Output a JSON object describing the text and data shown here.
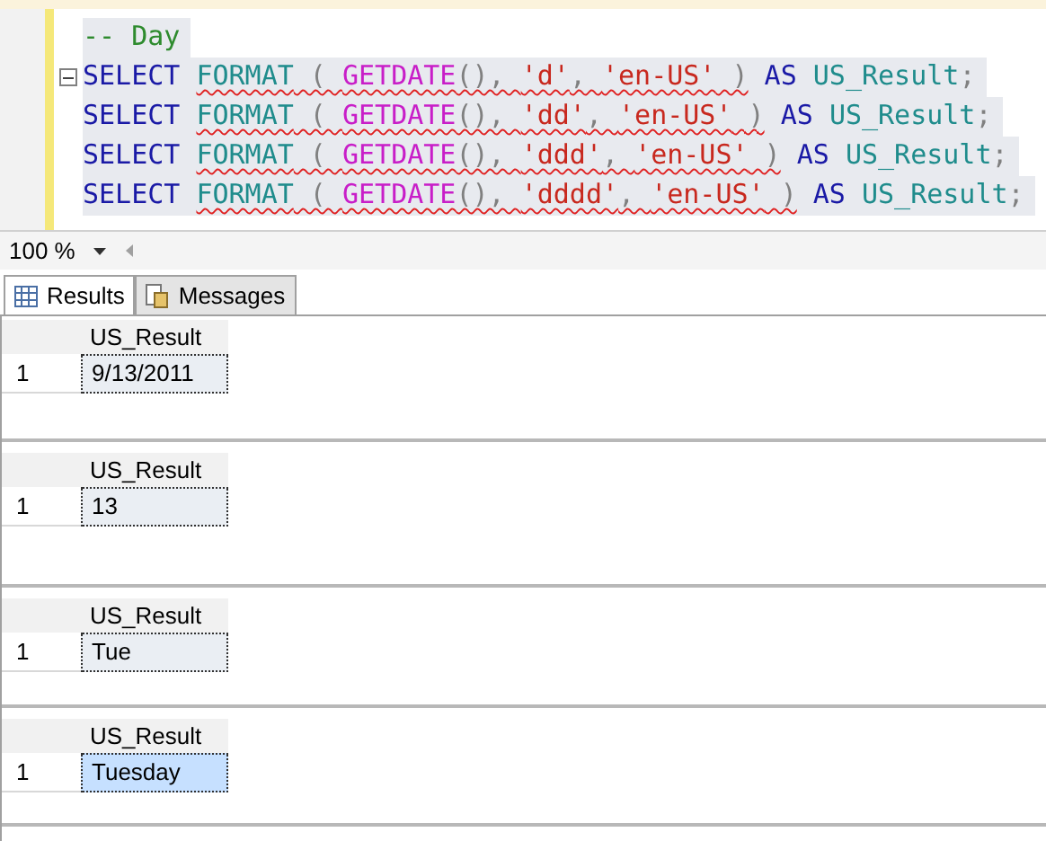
{
  "editor": {
    "lines": [
      {
        "collapse": false,
        "tokens": [
          {
            "kind": "comment",
            "text": "-- Day",
            "error": false
          }
        ]
      },
      {
        "collapse": true,
        "tokens": [
          {
            "kind": "keyword",
            "text": "SELECT ",
            "error": false
          },
          {
            "kind": "function",
            "text": "FORMAT",
            "error": true
          },
          {
            "kind": "punct",
            "text": " ( ",
            "error": true
          },
          {
            "kind": "system",
            "text": "GETDATE",
            "error": true
          },
          {
            "kind": "punct",
            "text": "(), ",
            "error": true
          },
          {
            "kind": "string",
            "text": "'d'",
            "error": true
          },
          {
            "kind": "punct",
            "text": ", ",
            "error": true
          },
          {
            "kind": "string",
            "text": "'en-US'",
            "error": true
          },
          {
            "kind": "punct",
            "text": " )",
            "error": true
          },
          {
            "kind": "keyword",
            "text": " AS ",
            "error": false
          },
          {
            "kind": "identifier",
            "text": "US_Result",
            "error": false
          },
          {
            "kind": "punct",
            "text": ";",
            "error": false
          }
        ]
      },
      {
        "collapse": false,
        "tokens": [
          {
            "kind": "keyword",
            "text": "SELECT ",
            "error": false
          },
          {
            "kind": "function",
            "text": "FORMAT",
            "error": true
          },
          {
            "kind": "punct",
            "text": " ( ",
            "error": true
          },
          {
            "kind": "system",
            "text": "GETDATE",
            "error": true
          },
          {
            "kind": "punct",
            "text": "(), ",
            "error": true
          },
          {
            "kind": "string",
            "text": "'dd'",
            "error": true
          },
          {
            "kind": "punct",
            "text": ", ",
            "error": true
          },
          {
            "kind": "string",
            "text": "'en-US'",
            "error": true
          },
          {
            "kind": "punct",
            "text": " )",
            "error": true
          },
          {
            "kind": "keyword",
            "text": " AS ",
            "error": false
          },
          {
            "kind": "identifier",
            "text": "US_Result",
            "error": false
          },
          {
            "kind": "punct",
            "text": ";",
            "error": false
          }
        ]
      },
      {
        "collapse": false,
        "tokens": [
          {
            "kind": "keyword",
            "text": "SELECT ",
            "error": false
          },
          {
            "kind": "function",
            "text": "FORMAT",
            "error": true
          },
          {
            "kind": "punct",
            "text": " ( ",
            "error": true
          },
          {
            "kind": "system",
            "text": "GETDATE",
            "error": true
          },
          {
            "kind": "punct",
            "text": "(), ",
            "error": true
          },
          {
            "kind": "string",
            "text": "'ddd'",
            "error": true
          },
          {
            "kind": "punct",
            "text": ", ",
            "error": true
          },
          {
            "kind": "string",
            "text": "'en-US'",
            "error": true
          },
          {
            "kind": "punct",
            "text": " )",
            "error": true
          },
          {
            "kind": "keyword",
            "text": " AS ",
            "error": false
          },
          {
            "kind": "identifier",
            "text": "US_Result",
            "error": false
          },
          {
            "kind": "punct",
            "text": ";",
            "error": false
          }
        ]
      },
      {
        "collapse": false,
        "tokens": [
          {
            "kind": "keyword",
            "text": "SELECT ",
            "error": false
          },
          {
            "kind": "function",
            "text": "FORMAT",
            "error": true
          },
          {
            "kind": "punct",
            "text": " ( ",
            "error": true
          },
          {
            "kind": "system",
            "text": "GETDATE",
            "error": true
          },
          {
            "kind": "punct",
            "text": "(), ",
            "error": true
          },
          {
            "kind": "string",
            "text": "'dddd'",
            "error": true
          },
          {
            "kind": "punct",
            "text": ", ",
            "error": true
          },
          {
            "kind": "string",
            "text": "'en-US'",
            "error": true
          },
          {
            "kind": "punct",
            "text": " )",
            "error": true
          },
          {
            "kind": "keyword",
            "text": " AS ",
            "error": false
          },
          {
            "kind": "identifier",
            "text": "US_Result",
            "error": false
          },
          {
            "kind": "punct",
            "text": ";",
            "error": false
          }
        ]
      }
    ]
  },
  "zoom": {
    "value": "100 %"
  },
  "tabs": [
    {
      "label": "Results",
      "selected": true
    },
    {
      "label": "Messages",
      "selected": false
    }
  ],
  "results": [
    {
      "column": "US_Result",
      "row_number": "1",
      "value": "9/13/2011",
      "selected": false
    },
    {
      "column": "US_Result",
      "row_number": "1",
      "value": "13",
      "selected": false
    },
    {
      "column": "US_Result",
      "row_number": "1",
      "value": "Tue",
      "selected": false
    },
    {
      "column": "US_Result",
      "row_number": "1",
      "value": "Tuesday",
      "selected": true
    }
  ]
}
